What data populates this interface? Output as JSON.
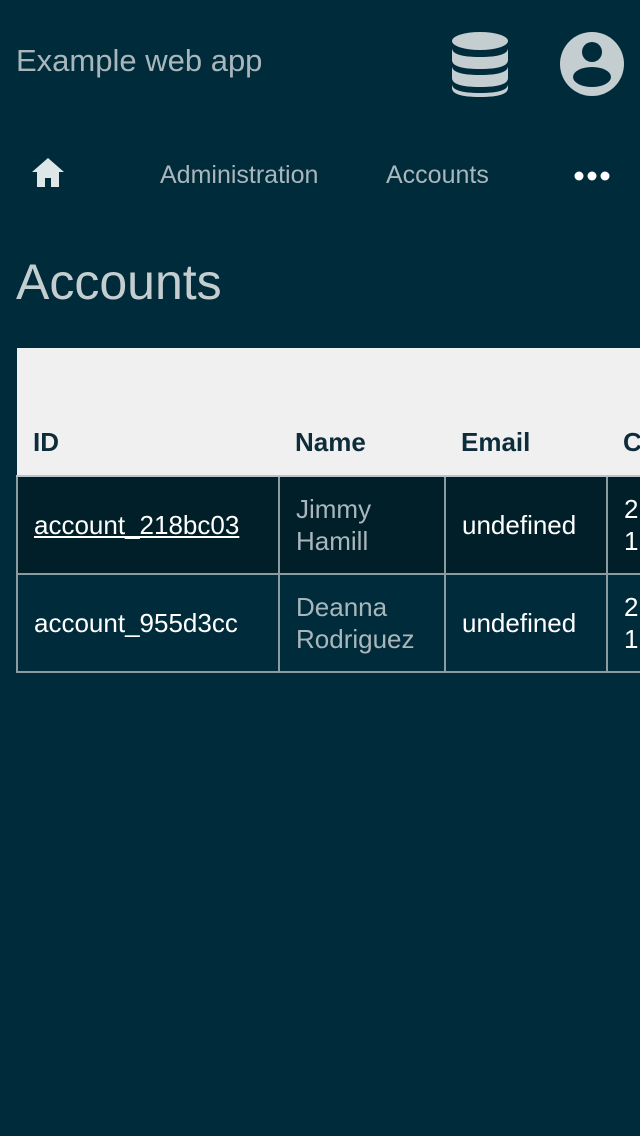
{
  "header": {
    "app_title": "Example web app",
    "icons": [
      "database-icon",
      "account-circle-icon"
    ]
  },
  "nav": {
    "home_icon": "home-icon",
    "items": [
      {
        "label": "Administration"
      },
      {
        "label": "Accounts"
      }
    ],
    "more_icon": "more-horizontal-icon"
  },
  "page": {
    "title": "Accounts"
  },
  "table": {
    "columns": [
      "ID",
      "Name",
      "Email",
      "C"
    ],
    "rows": [
      {
        "id": "account_218bc03",
        "name": "Jimmy Hamill",
        "email": "undefined",
        "created": "2\n1"
      },
      {
        "id": "account_955d3cc",
        "name": "Deanna Rodriguez",
        "email": "undefined",
        "created": "2\n1"
      }
    ]
  },
  "colors": {
    "background": "#002b3a",
    "header_row": "#f0f0f0",
    "highlight_row": "#001f29",
    "text_muted": "#a9b7bc"
  }
}
